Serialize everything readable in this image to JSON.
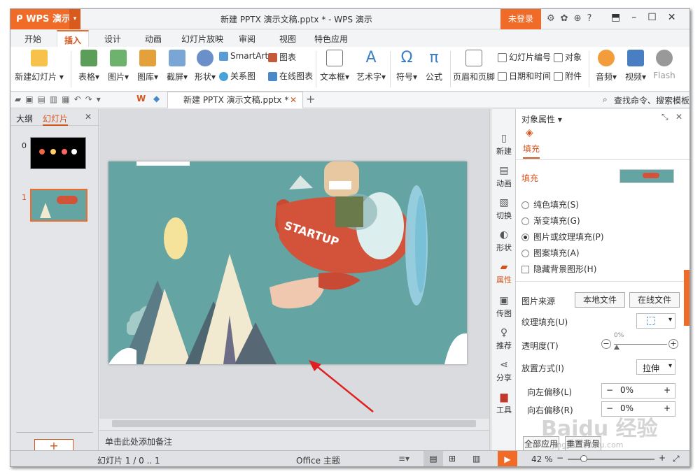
{
  "app": {
    "logo": "WPS 演示",
    "title": "新建 PPTX 演示文稿.pptx * - WPS 演示",
    "login": "未登录"
  },
  "menu": {
    "tabs": [
      "开始",
      "插入",
      "设计",
      "动画",
      "幻灯片放映",
      "审阅",
      "视图",
      "特色应用"
    ],
    "active": "插入"
  },
  "ribbon": {
    "new_slide": "新建幻灯片",
    "table": "表格",
    "picture": "图片",
    "gallery": "图库",
    "screenshot": "截屏",
    "shape": "形状",
    "smartart": "SmartArt",
    "chart": "图表",
    "relation": "关系图",
    "online_chart": "在线图表",
    "textbox": "文本框",
    "wordart": "艺术字",
    "symbol": "符号",
    "formula": "公式",
    "header_footer": "页眉和页脚",
    "slide_number": "幻灯片编号",
    "object": "对象",
    "datetime": "日期和时间",
    "attachment": "附件",
    "audio": "音频",
    "video": "视频",
    "flash": "Flash"
  },
  "toolbar": {
    "doc_tab": "新建 PPTX 演示文稿.pptx *",
    "search": "查找命令、搜索模板"
  },
  "left_panel": {
    "tab_outline": "大纲",
    "tab_slides": "幻灯片",
    "slide_numbers": [
      "0",
      "1"
    ]
  },
  "slide": {
    "airplane_text": "STARTUP"
  },
  "notes": "单击此处添加备注",
  "sidebar": [
    "新建",
    "动画",
    "切换",
    "形状",
    "属性",
    "传图",
    "推荐",
    "分享",
    "工具"
  ],
  "props": {
    "title": "对象属性",
    "fill_tab": "填充",
    "fill_section": "填充",
    "options": [
      "纯色填充(S)",
      "渐变填充(G)",
      "图片或纹理填充(P)",
      "图案填充(A)"
    ],
    "selected_option": 2,
    "hide_bg": "隐藏背景图形(H)",
    "pic_source": "图片来源",
    "local_file": "本地文件",
    "online_file": "在线文件",
    "texture_fill": "纹理填充(U)",
    "transparency": "透明度(T)",
    "transparency_value": "0%",
    "placement": "放置方式(I)",
    "placement_value": "拉伸",
    "offset_left": "向左偏移(L)",
    "offset_left_value": "0%",
    "offset_right": "向右偏移(R)",
    "offset_right_value": "0%",
    "apply_all": "全部应用",
    "reset": "重置背景"
  },
  "status": {
    "slide_info": "幻灯片 1 / 0 .. 1",
    "theme": "Office 主题",
    "zoom": "42 %"
  },
  "watermark": {
    "line1": "Baidu 经验",
    "line2": "jingyan.baidu.com"
  },
  "colors": {
    "accent": "#f06a28",
    "slide_bg": "#64a4a2"
  }
}
